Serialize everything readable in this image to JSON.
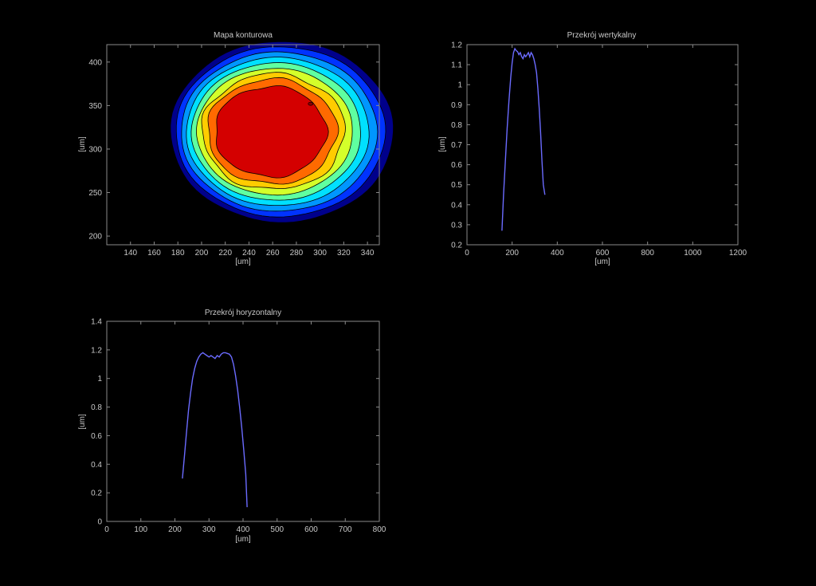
{
  "chart_data": [
    {
      "type": "contour",
      "title": "Mapa konturowa",
      "xlabel": "[um]",
      "ylabel": "[um]",
      "xlim": [
        120,
        350
      ],
      "ylim": [
        190,
        420
      ],
      "xticks": [
        140,
        160,
        180,
        200,
        220,
        240,
        260,
        280,
        300,
        320,
        340
      ],
      "yticks": [
        200,
        250,
        300,
        350,
        400
      ],
      "center": [
        263,
        320
      ],
      "radii": [
        94,
        104
      ],
      "levels": [
        {
          "scale": 1.0,
          "color": "#00008b"
        },
        {
          "scale": 0.94,
          "color": "#0033ff"
        },
        {
          "scale": 0.88,
          "color": "#0096ff"
        },
        {
          "scale": 0.82,
          "color": "#00e0ff"
        },
        {
          "scale": 0.76,
          "color": "#5fffa0"
        },
        {
          "scale": 0.7,
          "color": "#d4ff2a"
        },
        {
          "scale": 0.64,
          "color": "#ffcc00"
        },
        {
          "scale": 0.58,
          "color": "#ff6a00"
        },
        {
          "scale": 0.5,
          "color": "#d40000"
        }
      ]
    },
    {
      "type": "line",
      "title": "Przekrój wertykalny",
      "xlabel": "[um]",
      "ylabel": "[um]",
      "xlim": [
        0,
        1200
      ],
      "ylim": [
        0.2,
        1.2
      ],
      "xticks": [
        0,
        200,
        400,
        600,
        800,
        1000,
        1200
      ],
      "yticks": [
        0.2,
        0.3,
        0.4,
        0.5,
        0.6,
        0.7,
        0.8,
        0.9,
        1,
        1.1,
        1.2
      ],
      "color": "#6b6bff",
      "x": [
        155,
        162,
        170,
        178,
        186,
        194,
        200,
        206,
        212,
        218,
        224,
        230,
        236,
        242,
        248,
        254,
        260,
        266,
        272,
        278,
        284,
        290,
        296,
        302,
        308,
        314,
        320,
        326,
        332,
        338,
        345
      ],
      "y": [
        0.27,
        0.45,
        0.62,
        0.78,
        0.92,
        1.04,
        1.11,
        1.16,
        1.18,
        1.17,
        1.165,
        1.15,
        1.16,
        1.14,
        1.13,
        1.15,
        1.14,
        1.15,
        1.16,
        1.14,
        1.16,
        1.15,
        1.13,
        1.1,
        1.06,
        0.98,
        0.88,
        0.76,
        0.62,
        0.5,
        0.45
      ]
    },
    {
      "type": "line",
      "title": "Przekrój horyzontalny",
      "xlabel": "[um]",
      "ylabel": "[um]",
      "xlim": [
        0,
        800
      ],
      "ylim": [
        0,
        1.4
      ],
      "xticks": [
        0,
        100,
        200,
        300,
        400,
        500,
        600,
        700,
        800
      ],
      "yticks": [
        0,
        0.2,
        0.4,
        0.6,
        0.8,
        1,
        1.2,
        1.4
      ],
      "color": "#6b6bff",
      "x": [
        222,
        228,
        234,
        240,
        246,
        252,
        258,
        264,
        270,
        276,
        282,
        288,
        294,
        300,
        306,
        312,
        318,
        324,
        330,
        336,
        342,
        348,
        354,
        360,
        366,
        372,
        378,
        384,
        390,
        396,
        402,
        408,
        412
      ],
      "y": [
        0.3,
        0.46,
        0.62,
        0.78,
        0.9,
        1.0,
        1.07,
        1.12,
        1.15,
        1.17,
        1.18,
        1.17,
        1.16,
        1.15,
        1.16,
        1.15,
        1.14,
        1.16,
        1.15,
        1.17,
        1.18,
        1.18,
        1.175,
        1.17,
        1.15,
        1.1,
        1.02,
        0.92,
        0.8,
        0.66,
        0.5,
        0.33,
        0.1
      ]
    }
  ]
}
